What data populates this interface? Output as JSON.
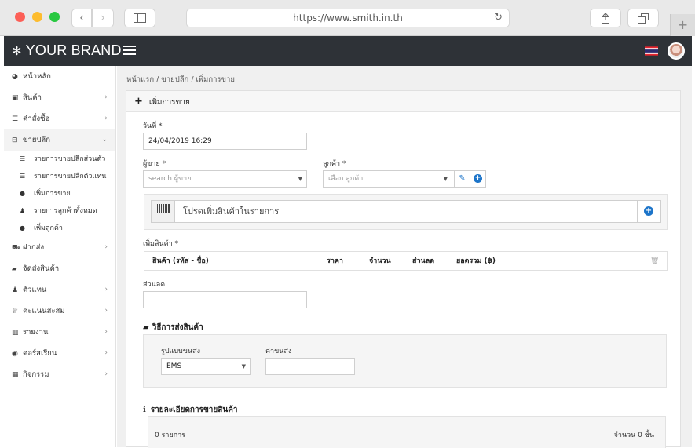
{
  "browser": {
    "url": "https://www.smith.in.th"
  },
  "header": {
    "brand": "YOUR BRAND"
  },
  "sidebar": {
    "items": [
      {
        "icon": "dashboard-icon",
        "label": "หน้าหลัก",
        "has_chevron": false
      },
      {
        "icon": "cubes-icon",
        "label": "สินค้า",
        "has_chevron": true
      },
      {
        "icon": "list-icon",
        "label": "คำสั่งซื้อ",
        "has_chevron": true
      },
      {
        "icon": "basket-icon",
        "label": "ขายปลีก",
        "has_chevron": true,
        "active": true
      },
      {
        "icon": "cart-icon",
        "label": "ฝากส่ง",
        "has_chevron": true
      },
      {
        "icon": "truck-icon",
        "label": "จัดส่งสินค้า",
        "has_chevron": false
      },
      {
        "icon": "users-icon",
        "label": "ตัวแทน",
        "has_chevron": true
      },
      {
        "icon": "trophy-icon",
        "label": "คะแนนสะสม",
        "has_chevron": true
      },
      {
        "icon": "chart-icon",
        "label": "รายงาน",
        "has_chevron": true
      },
      {
        "icon": "play-circle-icon",
        "label": "คอร์สเรียน",
        "has_chevron": true
      },
      {
        "icon": "calendar-icon",
        "label": "กิจกรรม",
        "has_chevron": true
      }
    ],
    "submenu": [
      {
        "icon": "list-icon",
        "label": "รายการขายปลีกส่วนตัว"
      },
      {
        "icon": "list-icon",
        "label": "รายการขายปลีกตัวแทน"
      },
      {
        "icon": "plus-circle-icon",
        "label": "เพิ่มการขาย"
      },
      {
        "icon": "users-icon",
        "label": "รายการลูกค้าทั้งหมด"
      },
      {
        "icon": "plus-circle-icon",
        "label": "เพิ่มลูกค้า"
      }
    ]
  },
  "breadcrumb": "หน้าแรก / ขายปลีก / เพิ่มการขาย",
  "form": {
    "card_title": "เพิ่มการขาย",
    "date_label": "วันที่ *",
    "date_value": "24/04/2019 16:29",
    "seller_label": "ผู้ขาย *",
    "seller_placeholder": "search ผู้ขาย",
    "customer_label": "ลูกค้า *",
    "customer_placeholder": "เลือก ลูกค้า",
    "scan_placeholder": "โปรดเพิ่มสินค้าในรายการ",
    "add_product_label": "เพิ่มสินค้า *",
    "table_headers": [
      "สินค้า (รหัส - ชื่อ)",
      "ราคา",
      "จำนวน",
      "ส่วนลด",
      "ยอดรวม (฿)"
    ],
    "discount_label": "ส่วนลด",
    "shipping_title": "วิธีการส่งสินค้า",
    "shipping_type_label": "รูปแบบขนส่ง",
    "shipping_type_value": "EMS",
    "shipping_cost_label": "ค่าขนส่ง",
    "details_title": "รายละเอียดการขายสินค้า",
    "items_count": "0 รายการ",
    "pieces_count": "จำนวน 0 ชิ้น"
  }
}
